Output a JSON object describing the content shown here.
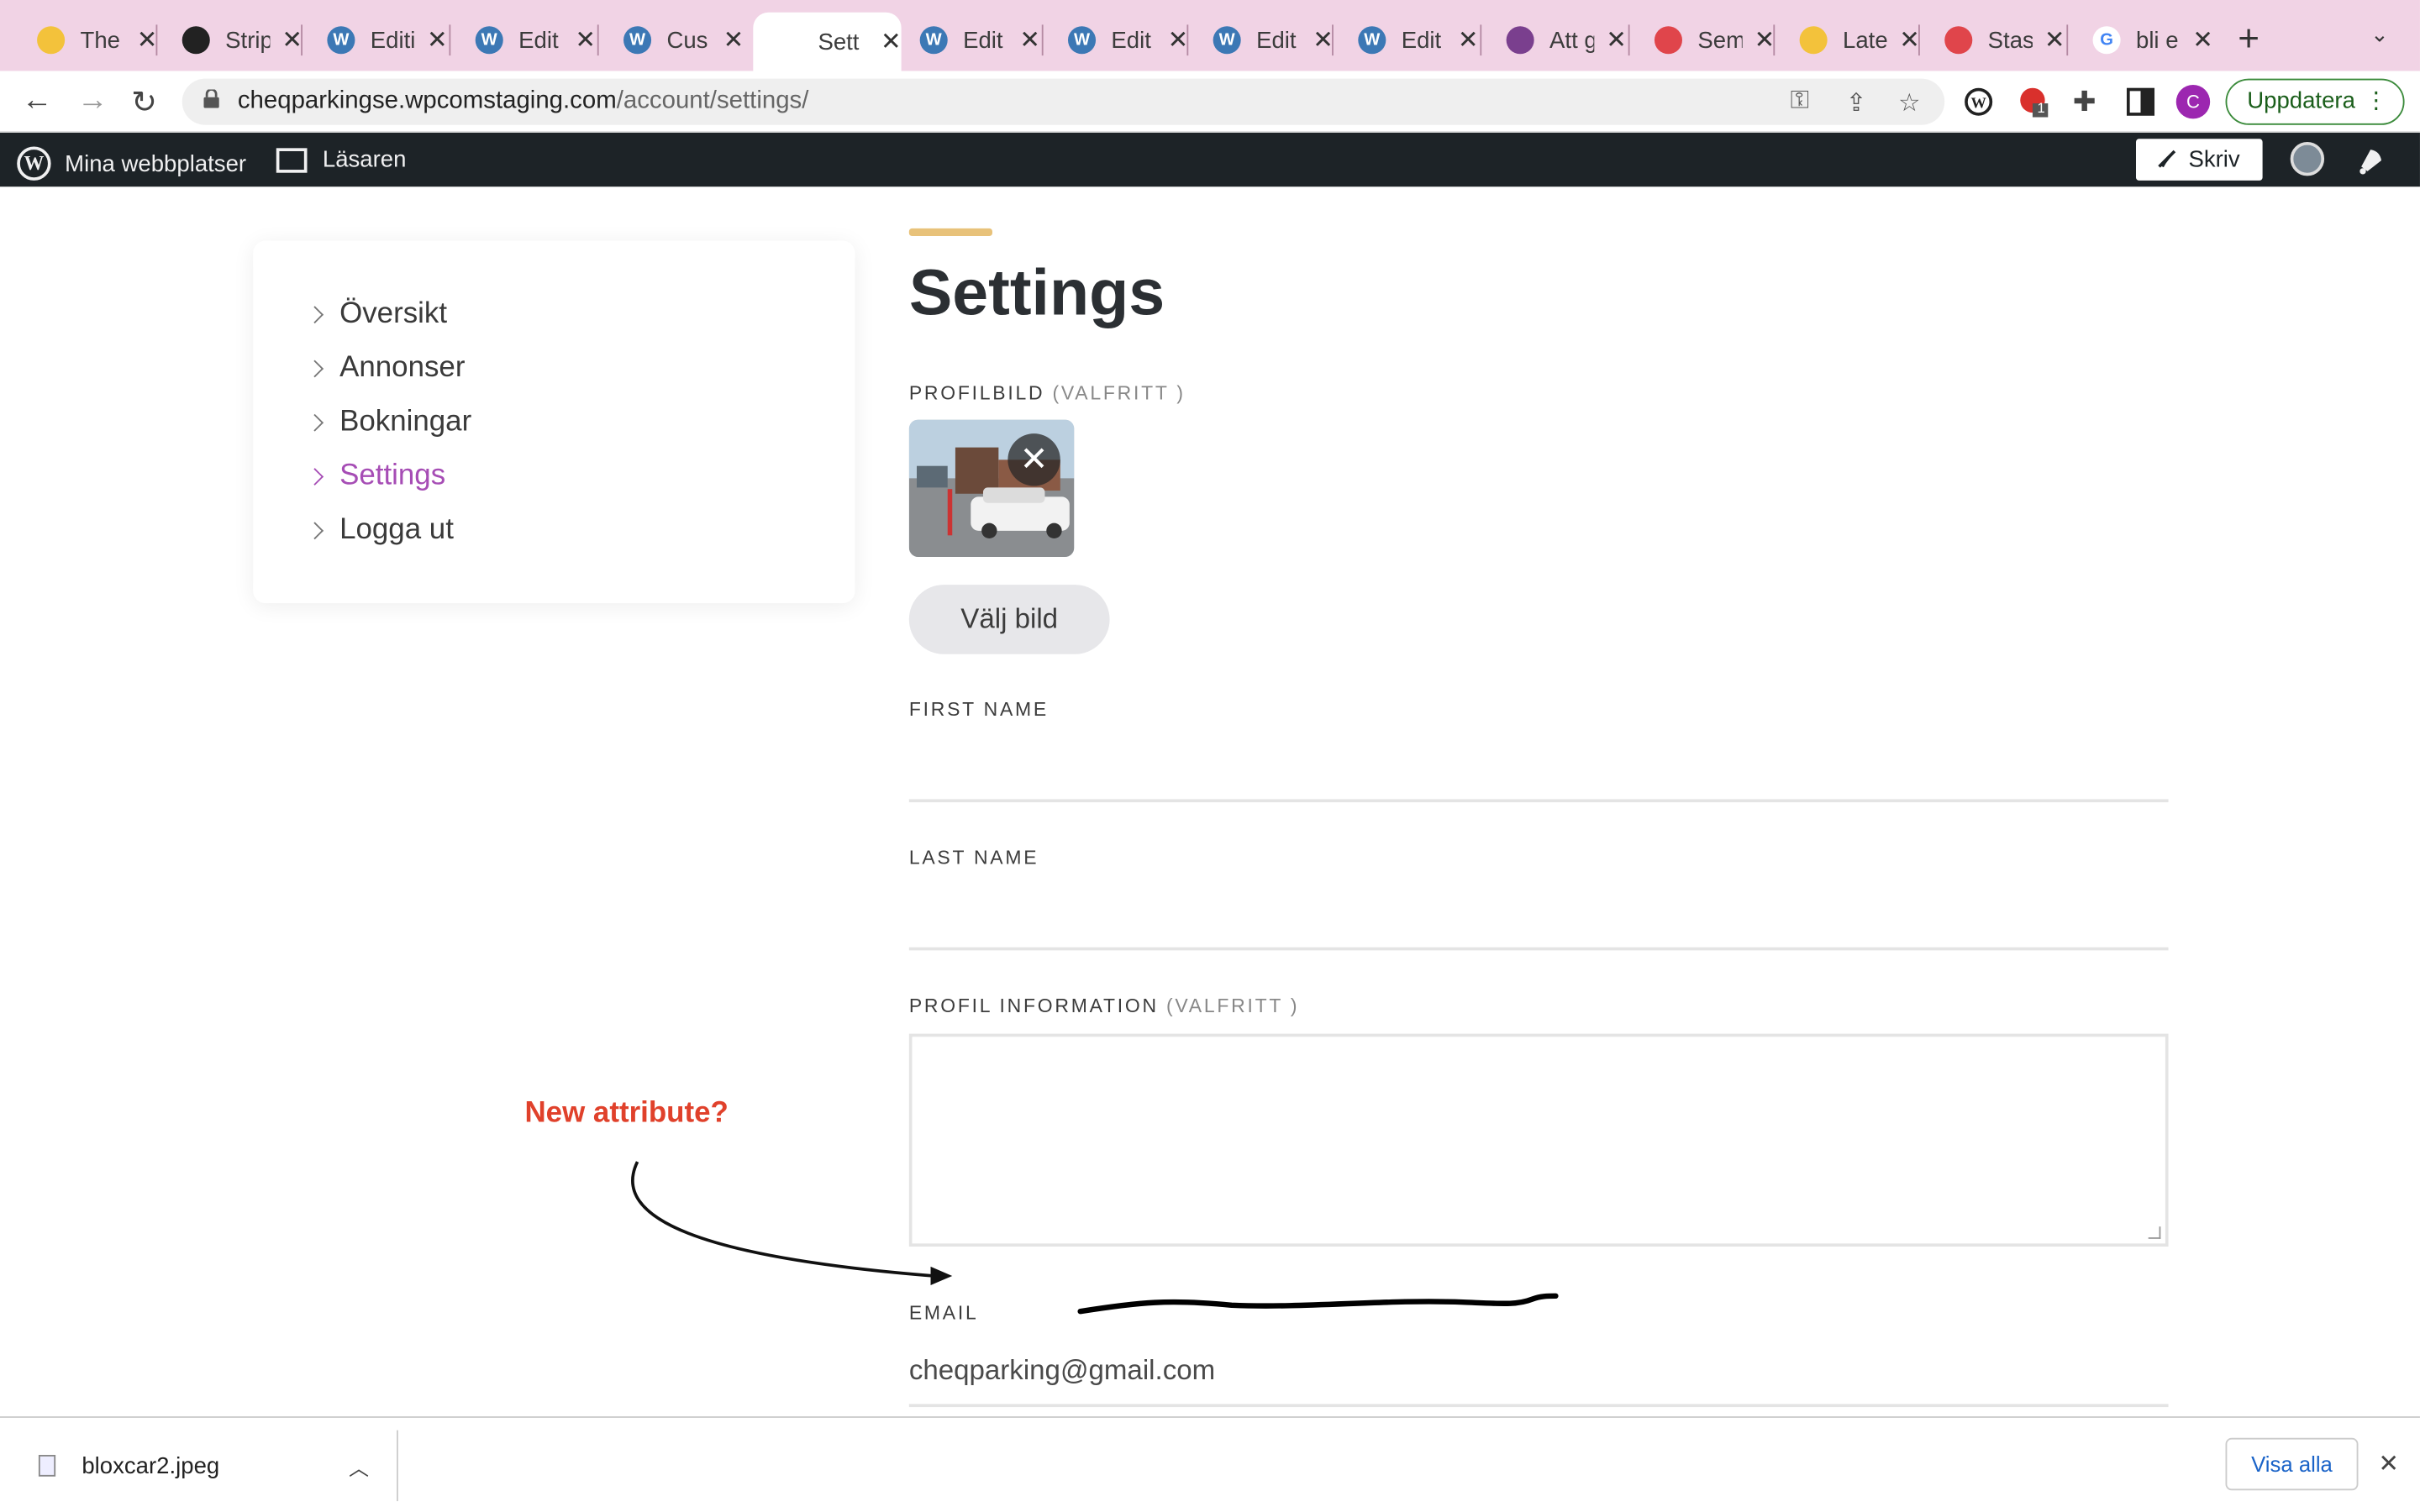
{
  "tabs": [
    {
      "title": "The",
      "icon": "flower-icon",
      "color": "#f3c23b"
    },
    {
      "title": "Strip",
      "icon": "stripe-icon",
      "color": "#222222"
    },
    {
      "title": "Editi",
      "icon": "wordpress-icon",
      "color": "#3c78b5"
    },
    {
      "title": "Edit",
      "icon": "wordpress-icon",
      "color": "#3c78b5"
    },
    {
      "title": "Cus",
      "icon": "wordpress-icon",
      "color": "#3c78b5"
    },
    {
      "title": "Sett",
      "icon": "blank-icon",
      "color": "#ffffff",
      "active": true
    },
    {
      "title": "Edit",
      "icon": "wordpress-icon",
      "color": "#3c78b5"
    },
    {
      "title": "Edit",
      "icon": "wordpress-icon",
      "color": "#3c78b5"
    },
    {
      "title": "Edit",
      "icon": "wordpress-icon",
      "color": "#3c78b5"
    },
    {
      "title": "Edit",
      "icon": "wordpress-icon",
      "color": "#3c78b5"
    },
    {
      "title": "Att g",
      "icon": "trello-icon",
      "color": "#7a3f8e"
    },
    {
      "title": "Sem",
      "icon": "airbnb-icon",
      "color": "#e0454b"
    },
    {
      "title": "Late",
      "icon": "flower-icon",
      "color": "#f3c23b"
    },
    {
      "title": "Stas",
      "icon": "asana-icon",
      "color": "#e0454b"
    },
    {
      "title": "bli e",
      "icon": "google-icon",
      "color": "#4285f4"
    }
  ],
  "address": {
    "domain": "cheqparkingse.wpcomstaging.com",
    "path": "/account/settings/"
  },
  "toolbar": {
    "profile_initial": "C",
    "update_label": "Uppdatera",
    "ext_badge": "1"
  },
  "wpbar": {
    "sites_label": "Mina webbplatser",
    "reader_label": "Läsaren",
    "write_label": "Skriv"
  },
  "sidebar": {
    "items": [
      {
        "label": "Översikt"
      },
      {
        "label": "Annonser"
      },
      {
        "label": "Bokningar"
      },
      {
        "label": "Settings",
        "active": true
      },
      {
        "label": "Logga ut"
      }
    ]
  },
  "main": {
    "title": "Settings",
    "profile_label": "PROFILBILD",
    "optional": "(VALFRITT )",
    "choose_image": "Välj bild",
    "first_name_label": "FIRST NAME",
    "first_name_value": "",
    "last_name_label": "LAST NAME",
    "last_name_value": "",
    "profile_info_label": "PROFIL INFORMATION",
    "email_label": "EMAIL",
    "email_value": "cheqparking@gmail.com"
  },
  "annotation": {
    "text": "New attribute?",
    "color": "#e0412b"
  },
  "downloads": {
    "file_name": "bloxcar2.jpeg",
    "show_all": "Visa alla"
  },
  "colors": {
    "accent": "#a64db5",
    "title_bar_accent": "#e8c27a",
    "tabstrip": "#f1d3e5"
  }
}
